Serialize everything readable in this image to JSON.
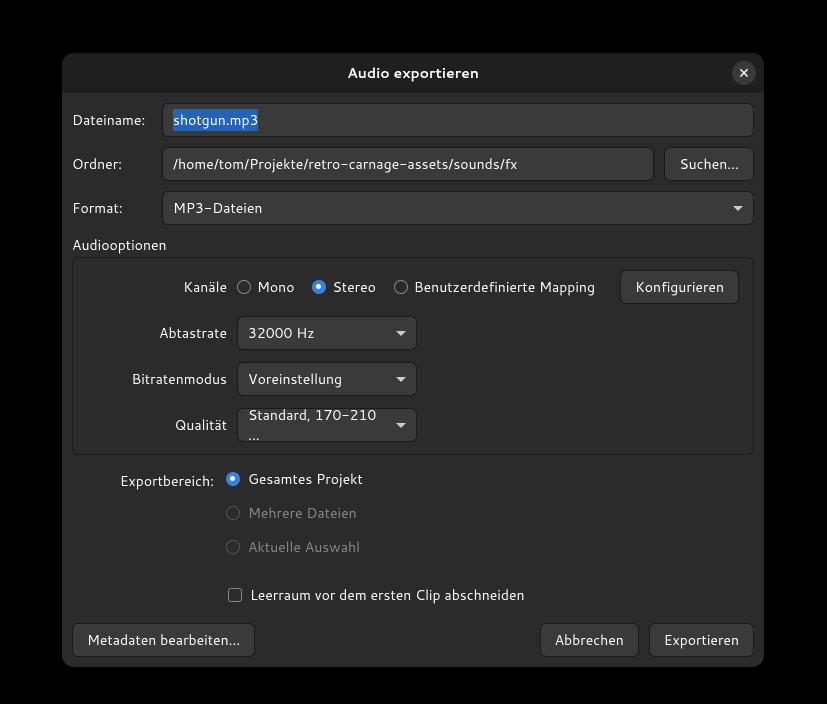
{
  "title": "Audio exportieren",
  "filename": {
    "label": "Dateiname:",
    "value": "shotgun.mp3"
  },
  "folder": {
    "label": "Ordner:",
    "value": "/home/tom/Projekte/retro-carnage-assets/sounds/fx",
    "browse": "Suchen…"
  },
  "format": {
    "label": "Format:",
    "value": "MP3-Dateien"
  },
  "audio_options": {
    "section": "Audiooptionen",
    "channels": {
      "label": "Kanäle",
      "mono": "Mono",
      "stereo": "Stereo",
      "custom": "Benutzerdefinierte Mapping",
      "configure": "Konfigurieren"
    },
    "sample_rate": {
      "label": "Abtastrate",
      "value": "32000 Hz"
    },
    "bitrate_mode": {
      "label": "Bitratenmodus",
      "value": "Voreinstellung"
    },
    "quality": {
      "label": "Qualität",
      "value": "Standard, 170-210 …"
    }
  },
  "export_range": {
    "label": "Exportbereich:",
    "full": "Gesamtes Projekt",
    "multiple": "Mehrere Dateien",
    "selection": "Aktuelle Auswahl"
  },
  "trim": "Leerraum vor dem ersten Clip abschneiden",
  "footer": {
    "metadata": "Metadaten bearbeiten…",
    "cancel": "Abbrechen",
    "export": "Exportieren"
  }
}
